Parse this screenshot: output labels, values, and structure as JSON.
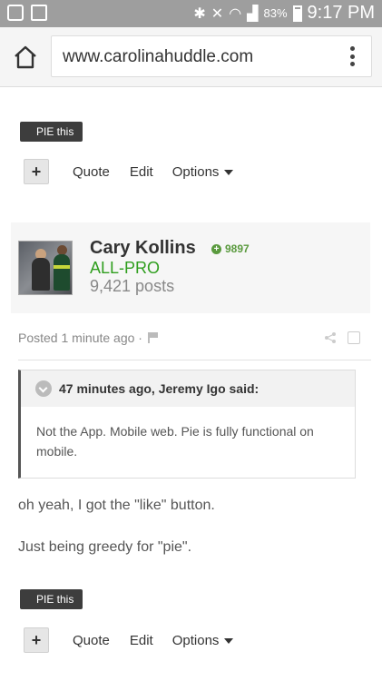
{
  "status_bar": {
    "battery_percent": "83%",
    "time": "9:17 PM"
  },
  "browser": {
    "url": "www.carolinahuddle.com"
  },
  "previous_post": {
    "pie_label": "PIE this",
    "actions": {
      "quote": "Quote",
      "edit": "Edit",
      "options": "Options"
    }
  },
  "post": {
    "author": {
      "name": "Cary Kollins",
      "reputation": "9897",
      "title": "ALL-PRO",
      "post_count": "9,421 posts"
    },
    "posted": "Posted 1 minute ago ·",
    "quote": {
      "attribution": "47 minutes ago, Jeremy Igo said:",
      "text": "Not the App. Mobile web. Pie is fully functional on mobile."
    },
    "body": [
      "oh yeah, I got the \"like\" button.",
      "Just being greedy for \"pie\"."
    ],
    "pie_label": "PIE this",
    "actions": {
      "quote": "Quote",
      "edit": "Edit",
      "options": "Options"
    }
  }
}
